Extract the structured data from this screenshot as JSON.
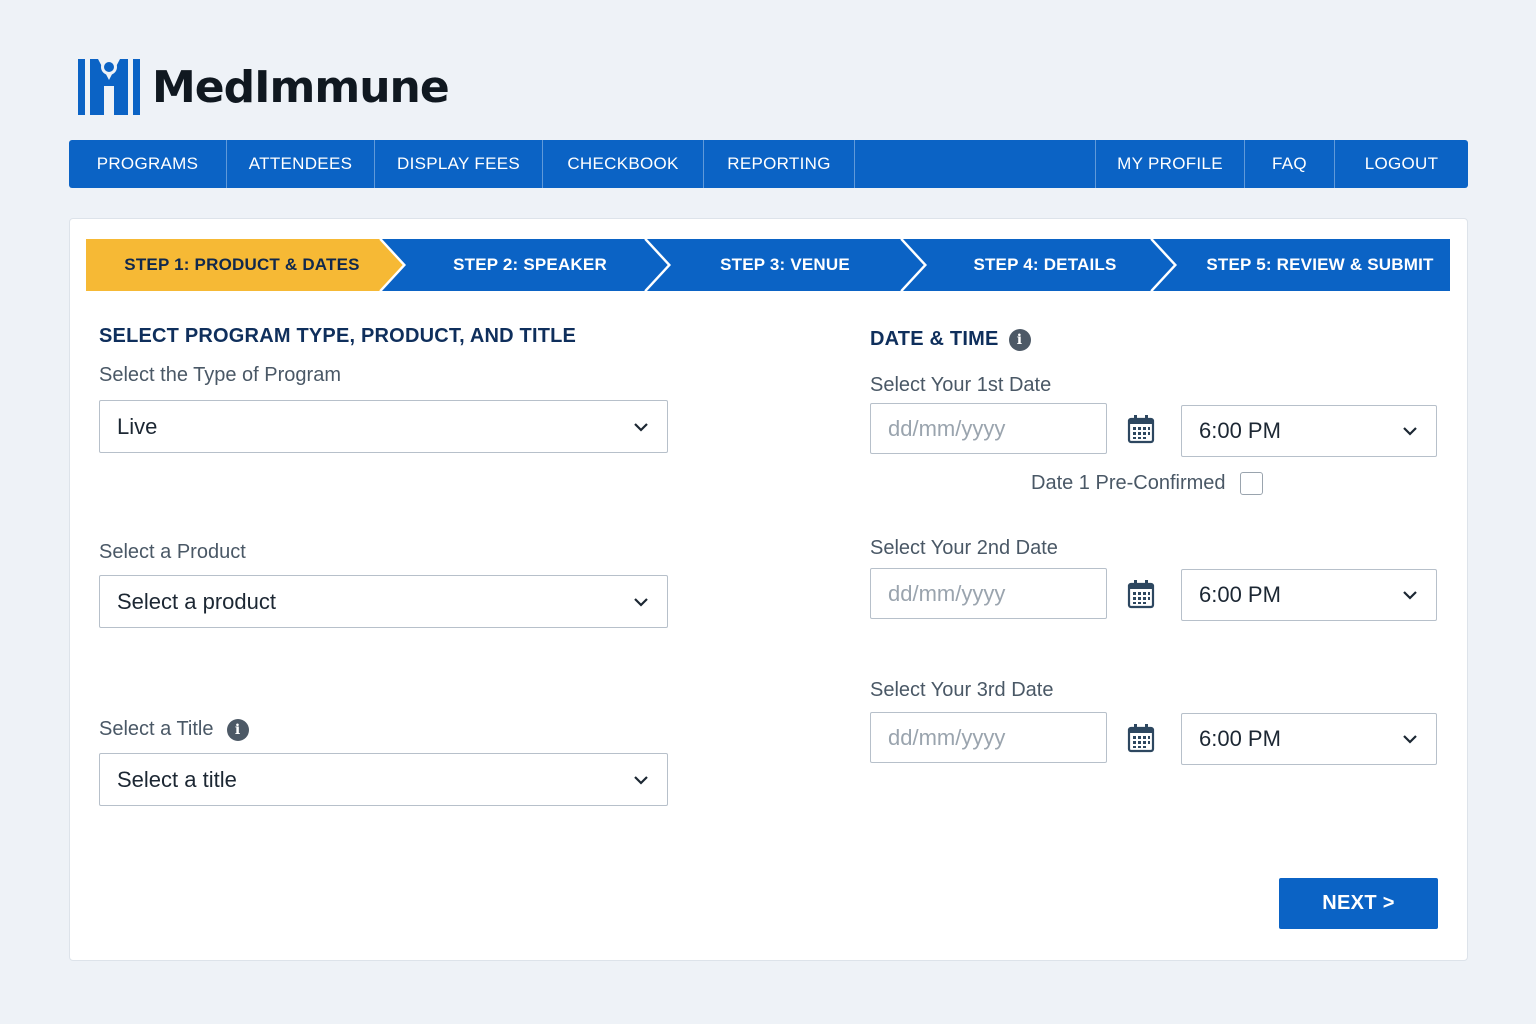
{
  "brand": {
    "name": "MedImmune",
    "logo_color": "#0b63c5",
    "icon": "medimmune-logo-icon"
  },
  "topnav": {
    "left": [
      "PROGRAMS",
      "ATTENDEES",
      "DISPLAY FEES",
      "CHECKBOOK",
      "REPORTING"
    ],
    "right": [
      "MY PROFILE",
      "FAQ",
      "LOGOUT"
    ],
    "background": "#0b63c5"
  },
  "stepper": {
    "steps": [
      {
        "label": "STEP 1: PRODUCT & DATES",
        "active": true
      },
      {
        "label": "STEP 2: SPEAKER",
        "active": false
      },
      {
        "label": "STEP 3: VENUE",
        "active": false
      },
      {
        "label": "STEP 4: DETAILS",
        "active": false
      },
      {
        "label": "STEP 5: REVIEW & SUBMIT",
        "active": false
      }
    ],
    "active_color": "#f6b935",
    "inactive_color": "#0b63c5"
  },
  "program": {
    "section_title": "SELECT PROGRAM TYPE, PRODUCT, AND TITLE",
    "type": {
      "label": "Select the Type of Program",
      "value": "Live"
    },
    "product": {
      "label": "Select a Product",
      "value": "Select a product"
    },
    "title": {
      "label": "Select a Title",
      "value": "Select a title",
      "info_icon": "info-icon"
    }
  },
  "datetime": {
    "section_title": "DATE & TIME",
    "info_icon": "info-icon",
    "dates": [
      {
        "label": "Select Your 1st Date",
        "placeholder": "dd/mm/yyyy",
        "time": "6:00 PM"
      },
      {
        "label": "Select Your 2nd Date",
        "placeholder": "dd/mm/yyyy",
        "time": "6:00 PM"
      },
      {
        "label": "Select Your 3rd Date",
        "placeholder": "dd/mm/yyyy",
        "time": "6:00 PM"
      }
    ],
    "preconfirmed_label": "Date 1 Pre-Confirmed",
    "preconfirmed_checked": false
  },
  "actions": {
    "next_label": "NEXT >"
  }
}
